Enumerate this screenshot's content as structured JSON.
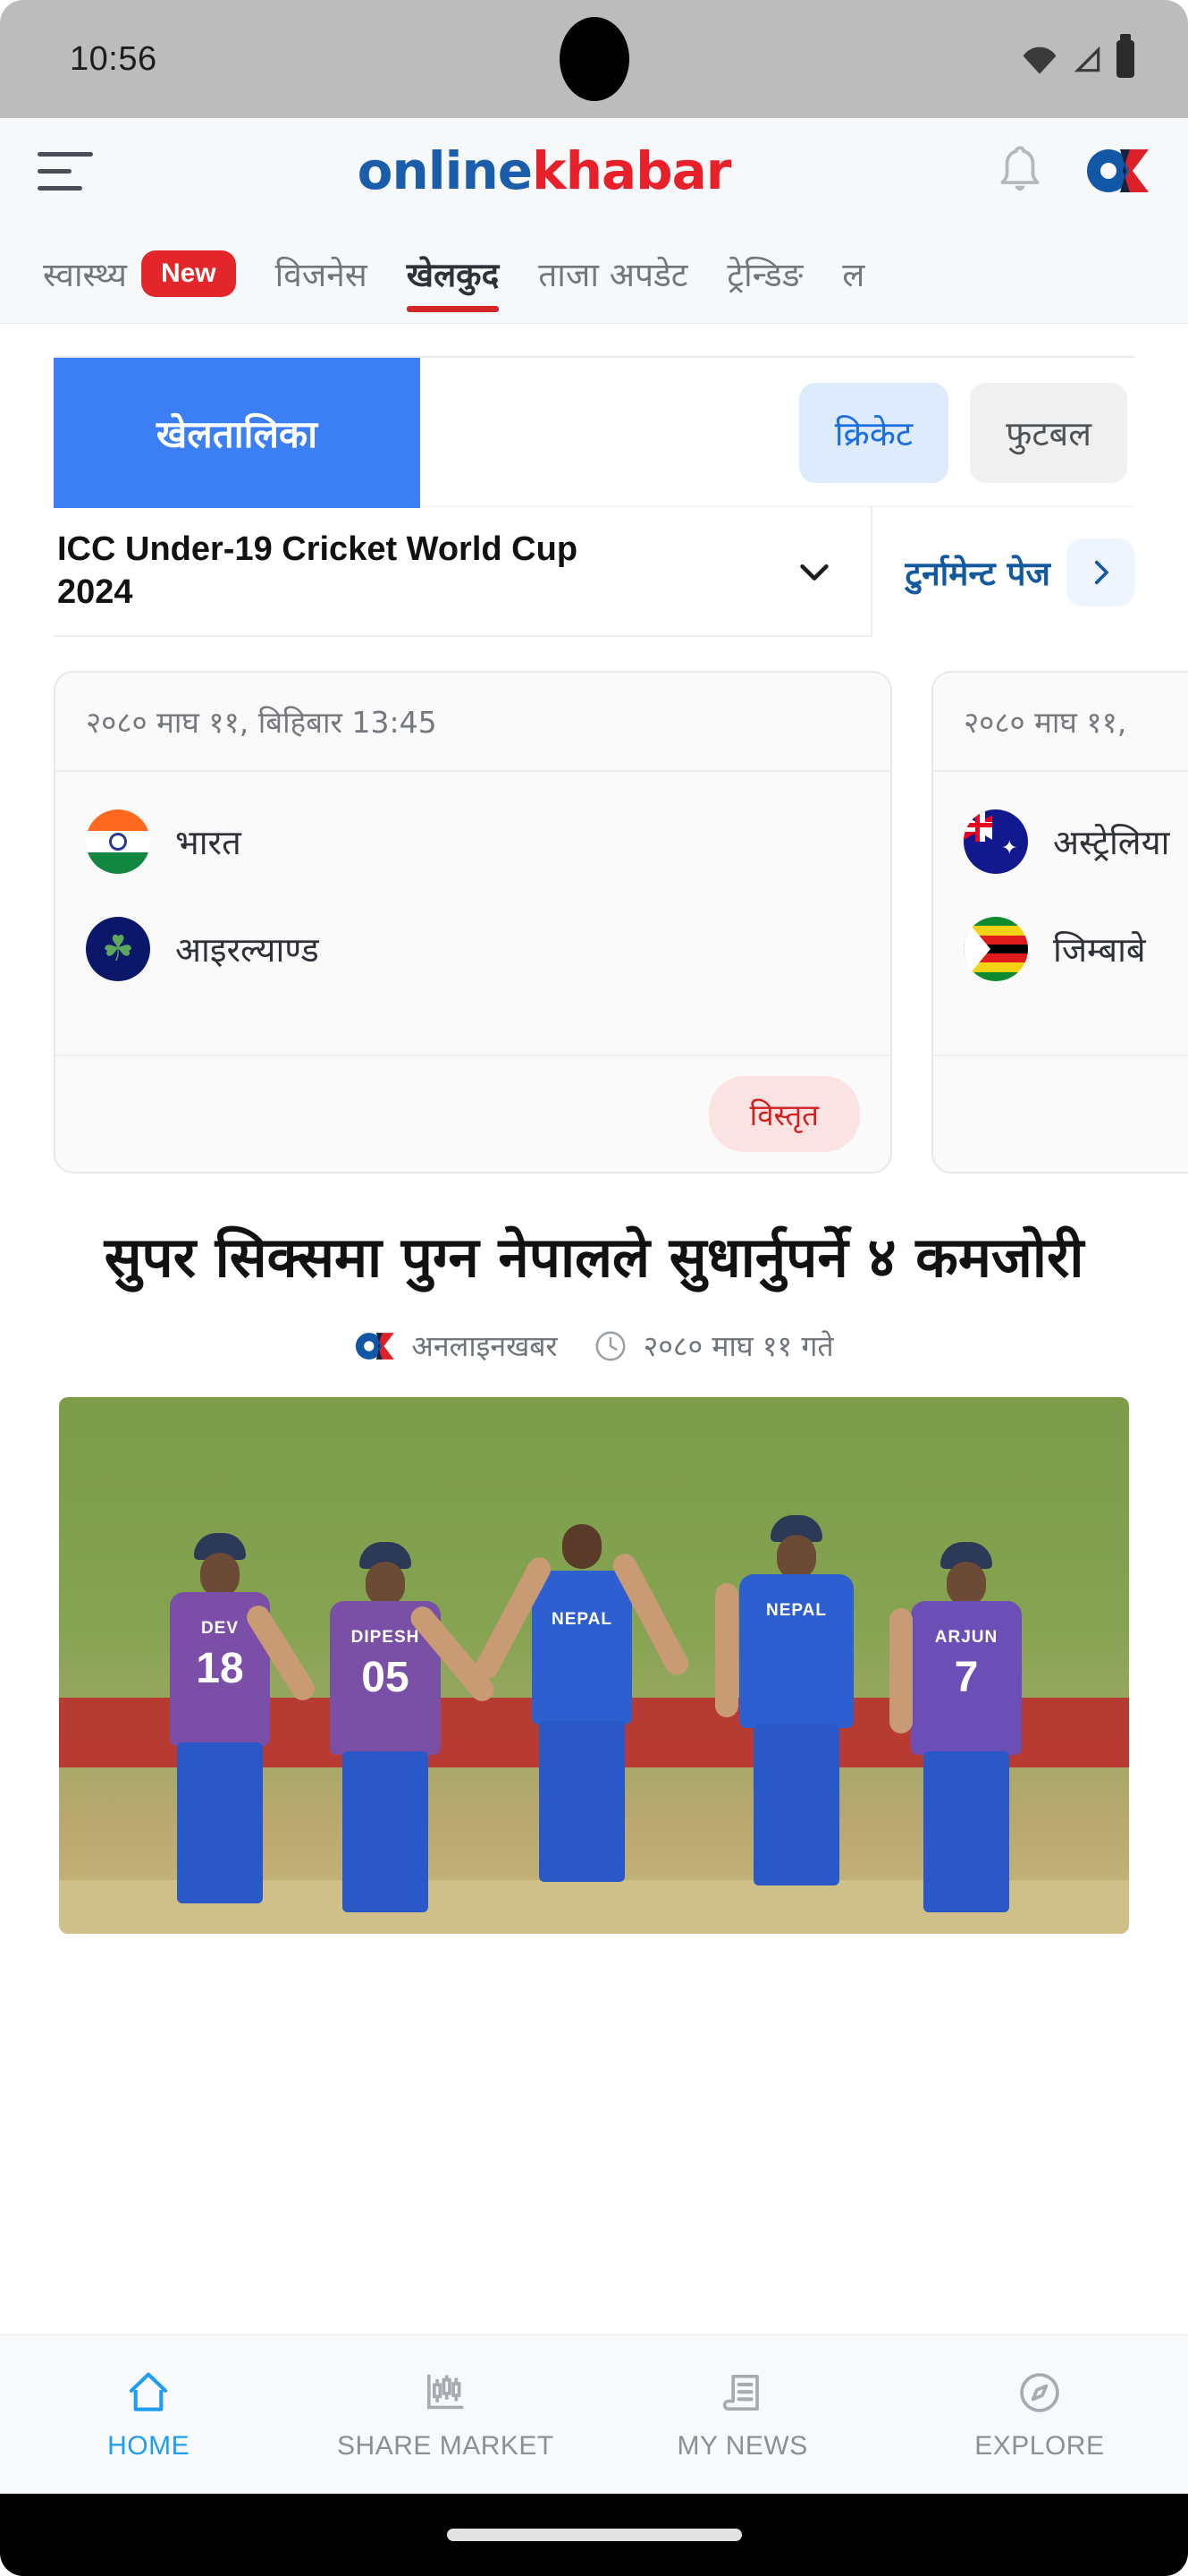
{
  "status_bar": {
    "time": "10:56",
    "icons": [
      "wifi-icon",
      "signal-icon",
      "battery-icon"
    ]
  },
  "header": {
    "menu_icon": "hamburger-menu-icon",
    "brand_part1": "online",
    "brand_part2": "khabar",
    "bell_icon": "notification-bell-icon",
    "logo_icon": "onlinekhabar-ok-logo"
  },
  "category_tabs": [
    {
      "label": "स्वास्थ्य",
      "badge": "New",
      "active": false
    },
    {
      "label": "विजनेस",
      "badge": "",
      "active": false
    },
    {
      "label": "खेलकुद",
      "badge": "",
      "active": true
    },
    {
      "label": "ताजा अपडेट",
      "badge": "",
      "active": false
    },
    {
      "label": "ट्रेन्डिङ",
      "badge": "",
      "active": false
    },
    {
      "label": "ल",
      "badge": "",
      "active": false
    }
  ],
  "sports_widget": {
    "title_block": "खेलतालिका",
    "sport_chips": [
      {
        "label": "क्रिकेट",
        "active": true
      },
      {
        "label": "फुटबल",
        "active": false
      }
    ],
    "tournament": {
      "name": "ICC Under-19 Cricket World Cup 2024",
      "dropdown_icon": "chevron-down-icon",
      "page_link_label": "टुर्नामेन्ट पेज",
      "page_link_icon": "chevron-right-icon"
    },
    "matches": [
      {
        "datetime": "२०८० माघ ११, बिहिबार 13:45",
        "team1": {
          "name": "भारत",
          "flag": "india-flag"
        },
        "team2": {
          "name": "आइरल्याण्ड",
          "flag": "ireland-flag"
        },
        "action_label": "विस्तृत"
      },
      {
        "datetime": "२०८० माघ ११, ",
        "team1": {
          "name": "अस्ट्रेलिया",
          "flag": "australia-flag"
        },
        "team2": {
          "name": "जिम्बाबे",
          "flag": "zimbabwe-flag"
        },
        "action_label": ""
      }
    ]
  },
  "article": {
    "headline": "सुपर सिक्समा पुग्न नेपालले सुधार्नुपर्ने ४ कमजोरी",
    "source_logo": "onlinekhabar-ok-logo",
    "source": "अनलाइनखबर",
    "time_icon": "clock-icon",
    "date": "२०८० माघ ११ गते",
    "image_alt": "nepal-cricket-team-celebrating",
    "image_jerseys": [
      {
        "name": "DEV",
        "number": "18"
      },
      {
        "name": "DIPESH",
        "number": "05"
      },
      {
        "name": "NEPAL",
        "number": ""
      },
      {
        "name": "NEPAL",
        "number": ""
      },
      {
        "name": "ARJUN",
        "number": "7"
      }
    ]
  },
  "bottom_nav": [
    {
      "label": "HOME",
      "icon": "home-icon",
      "active": true
    },
    {
      "label": "SHARE MARKET",
      "icon": "candlestick-chart-icon",
      "active": false
    },
    {
      "label": "MY NEWS",
      "icon": "news-document-icon",
      "active": false
    },
    {
      "label": "EXPLORE",
      "icon": "compass-icon",
      "active": false
    }
  ],
  "colors": {
    "brand_blue": "#1a5dab",
    "brand_red": "#e8202a",
    "accent_blue": "#3c7ef4",
    "active_tab_underline": "#d42626",
    "nav_active": "#1f9ef0"
  }
}
